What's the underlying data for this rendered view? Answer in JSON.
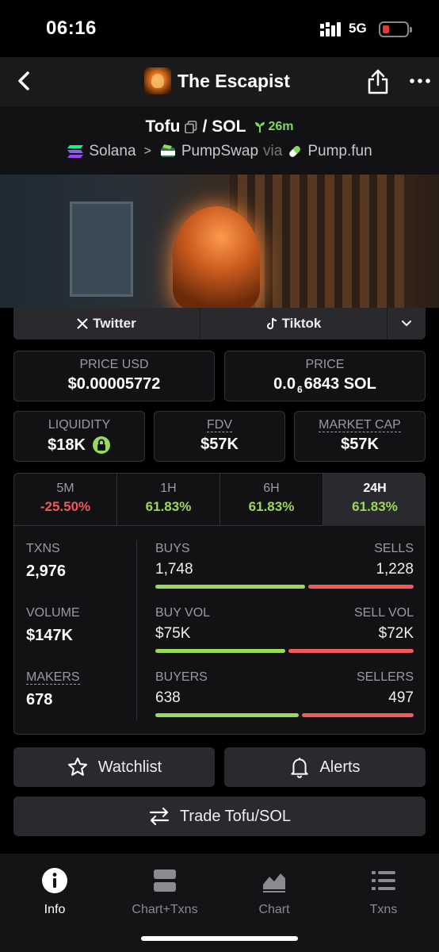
{
  "status": {
    "time": "06:16",
    "network": "5G"
  },
  "header": {
    "title": "The Escapist"
  },
  "pair": {
    "base": "Tofu",
    "separator": "/",
    "quote": "SOL",
    "age": "26m",
    "chain": "Solana",
    "dex": "PumpSwap",
    "via": "via",
    "launchpad": "Pump.fun"
  },
  "social": {
    "twitter": "Twitter",
    "tiktok": "Tiktok"
  },
  "price": {
    "usd_label": "PRICE USD",
    "usd_value": "$0.00005772",
    "native_label": "PRICE",
    "native_prefix": "0.0",
    "native_zeros": "6",
    "native_digits": "6843 SOL"
  },
  "metrics": {
    "liquidity_label": "LIQUIDITY",
    "liquidity_value": "$18K",
    "fdv_label": "FDV",
    "fdv_value": "$57K",
    "mcap_label": "MARKET CAP",
    "mcap_value": "$57K"
  },
  "timeframes": [
    {
      "label": "5M",
      "value": "-25.50%"
    },
    {
      "label": "1H",
      "value": "61.83%"
    },
    {
      "label": "6H",
      "value": "61.83%"
    },
    {
      "label": "24H",
      "value": "61.83%"
    }
  ],
  "stats": {
    "txns_label": "TXNS",
    "txns_value": "2,976",
    "volume_label": "VOLUME",
    "volume_value": "$147K",
    "makers_label": "MAKERS",
    "makers_value": "678",
    "buys_label": "BUYS",
    "buys_value": "1,748",
    "sells_label": "SELLS",
    "sells_value": "1,228",
    "buy_ratio": 0.587,
    "buyvol_label": "BUY VOL",
    "buyvol_value": "$75K",
    "sellvol_label": "SELL VOL",
    "sellvol_value": "$72K",
    "vol_ratio": 0.51,
    "buyers_label": "BUYERS",
    "buyers_value": "638",
    "sellers_label": "SELLERS",
    "sellers_value": "497",
    "buyers_ratio": 0.562
  },
  "actions": {
    "watchlist": "Watchlist",
    "alerts": "Alerts",
    "trade": "Trade Tofu/SOL"
  },
  "tabs": [
    {
      "label": "Info"
    },
    {
      "label": "Chart+Txns"
    },
    {
      "label": "Chart"
    },
    {
      "label": "Txns"
    }
  ],
  "colors": {
    "positive": "#9ad85a",
    "negative": "#f05a5a",
    "accent_age": "#7ed957"
  }
}
